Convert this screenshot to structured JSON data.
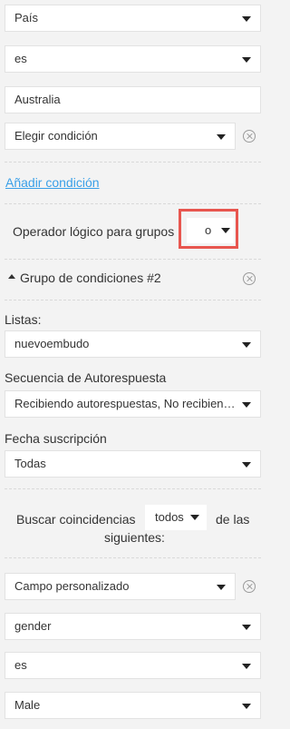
{
  "condition1": {
    "field_select": "País",
    "operator_select": "es",
    "value_input": "Australia",
    "condition_select": "Elegir condición",
    "add_condition_link": "Añadir condición"
  },
  "logic": {
    "label": "Operador lógico para grupos",
    "value": "o"
  },
  "group2": {
    "header": "Grupo de condiciones #2",
    "lists_label": "Listas:",
    "lists_value": "nuevoembudo",
    "autoresponse_label": "Secuencia de Autorespuesta",
    "autoresponse_value": "Recibiendo autorespuestas, No recibiendo autorespuestas",
    "subscription_label": "Fecha suscripción",
    "subscription_value": "Todas",
    "match_prefix": "Buscar coincidencias",
    "match_value": "todos",
    "match_suffix": "de las",
    "match_suffix2": "siguientes:",
    "custom_field_select": "Campo personalizado",
    "custom_field_name": "gender",
    "custom_operator": "es",
    "custom_value": "Male"
  },
  "colors": {
    "highlight": "#e8564f",
    "link": "#3aa0e8"
  }
}
